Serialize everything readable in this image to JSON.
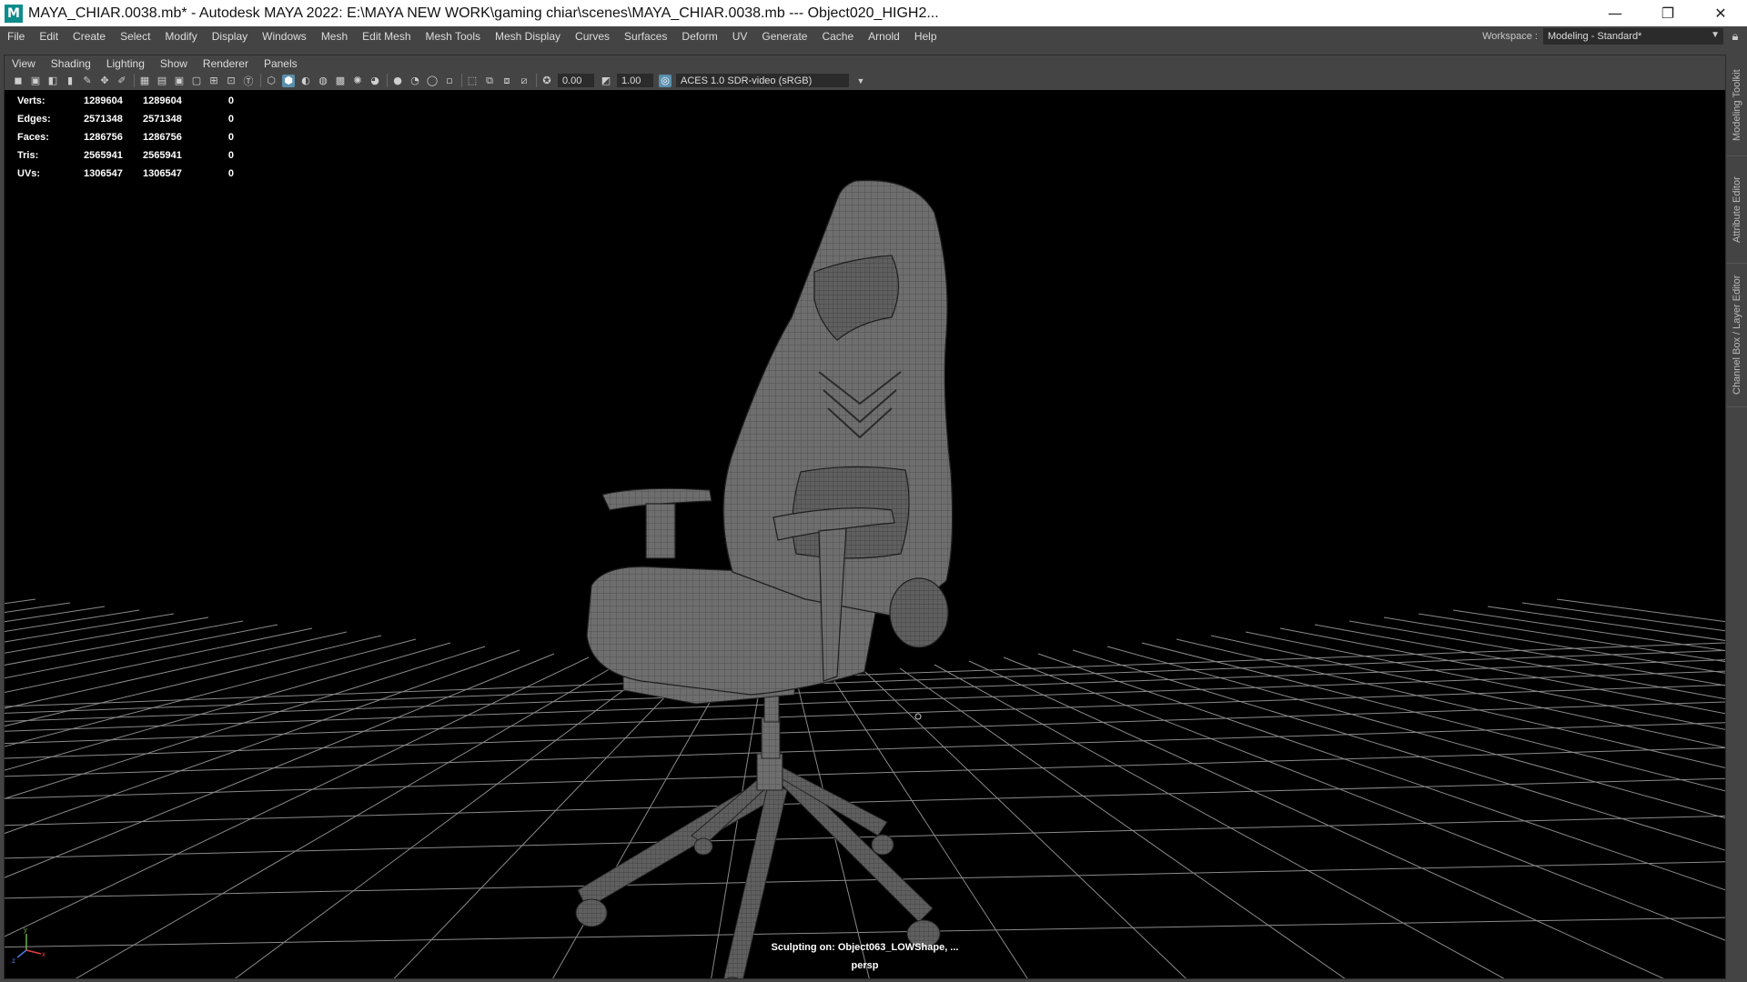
{
  "window": {
    "app_icon": "M",
    "title": "MAYA_CHIAR.0038.mb* - Autodesk MAYA 2022: E:\\MAYA NEW WORK\\gaming chiar\\scenes\\MAYA_CHIAR.0038.mb   ---   Object020_HIGH2..."
  },
  "main_menu": [
    "File",
    "Edit",
    "Create",
    "Select",
    "Modify",
    "Display",
    "Windows",
    "Mesh",
    "Edit Mesh",
    "Mesh Tools",
    "Mesh Display",
    "Curves",
    "Surfaces",
    "Deform",
    "UV",
    "Generate",
    "Cache",
    "Arnold",
    "Help"
  ],
  "workspace": {
    "label": "Workspace :",
    "value": "Modeling - Standard*"
  },
  "panel_menu": [
    "View",
    "Shading",
    "Lighting",
    "Show",
    "Renderer",
    "Panels"
  ],
  "toolbar": {
    "exposure": "0.00",
    "gamma": "1.00",
    "color_space": "ACES 1.0 SDR-video (sRGB)"
  },
  "hud": {
    "rows": [
      {
        "label": "Verts:",
        "a": "1289604",
        "b": "1289604",
        "c": "0"
      },
      {
        "label": "Edges:",
        "a": "2571348",
        "b": "2571348",
        "c": "0"
      },
      {
        "label": "Faces:",
        "a": "1286756",
        "b": "1286756",
        "c": "0"
      },
      {
        "label": "Tris:",
        "a": "2565941",
        "b": "2565941",
        "c": "0"
      },
      {
        "label": "UVs:",
        "a": "1306547",
        "b": "1306547",
        "c": "0"
      }
    ]
  },
  "status": {
    "sculpting": "Sculpting on: Object063_LOWShape, ...",
    "camera": "persp"
  },
  "side_tabs": [
    "Modeling Toolkit",
    "Attribute Editor",
    "Channel Box / Layer Editor"
  ],
  "axis_labels": {
    "x": "x",
    "y": "y",
    "z": "z"
  },
  "colors": {
    "viewport_bg": "#000000",
    "ui_bg": "#444444",
    "grid": "#8a8a8a",
    "mesh": "#7a7a7a",
    "accent": "#5b8fae"
  }
}
